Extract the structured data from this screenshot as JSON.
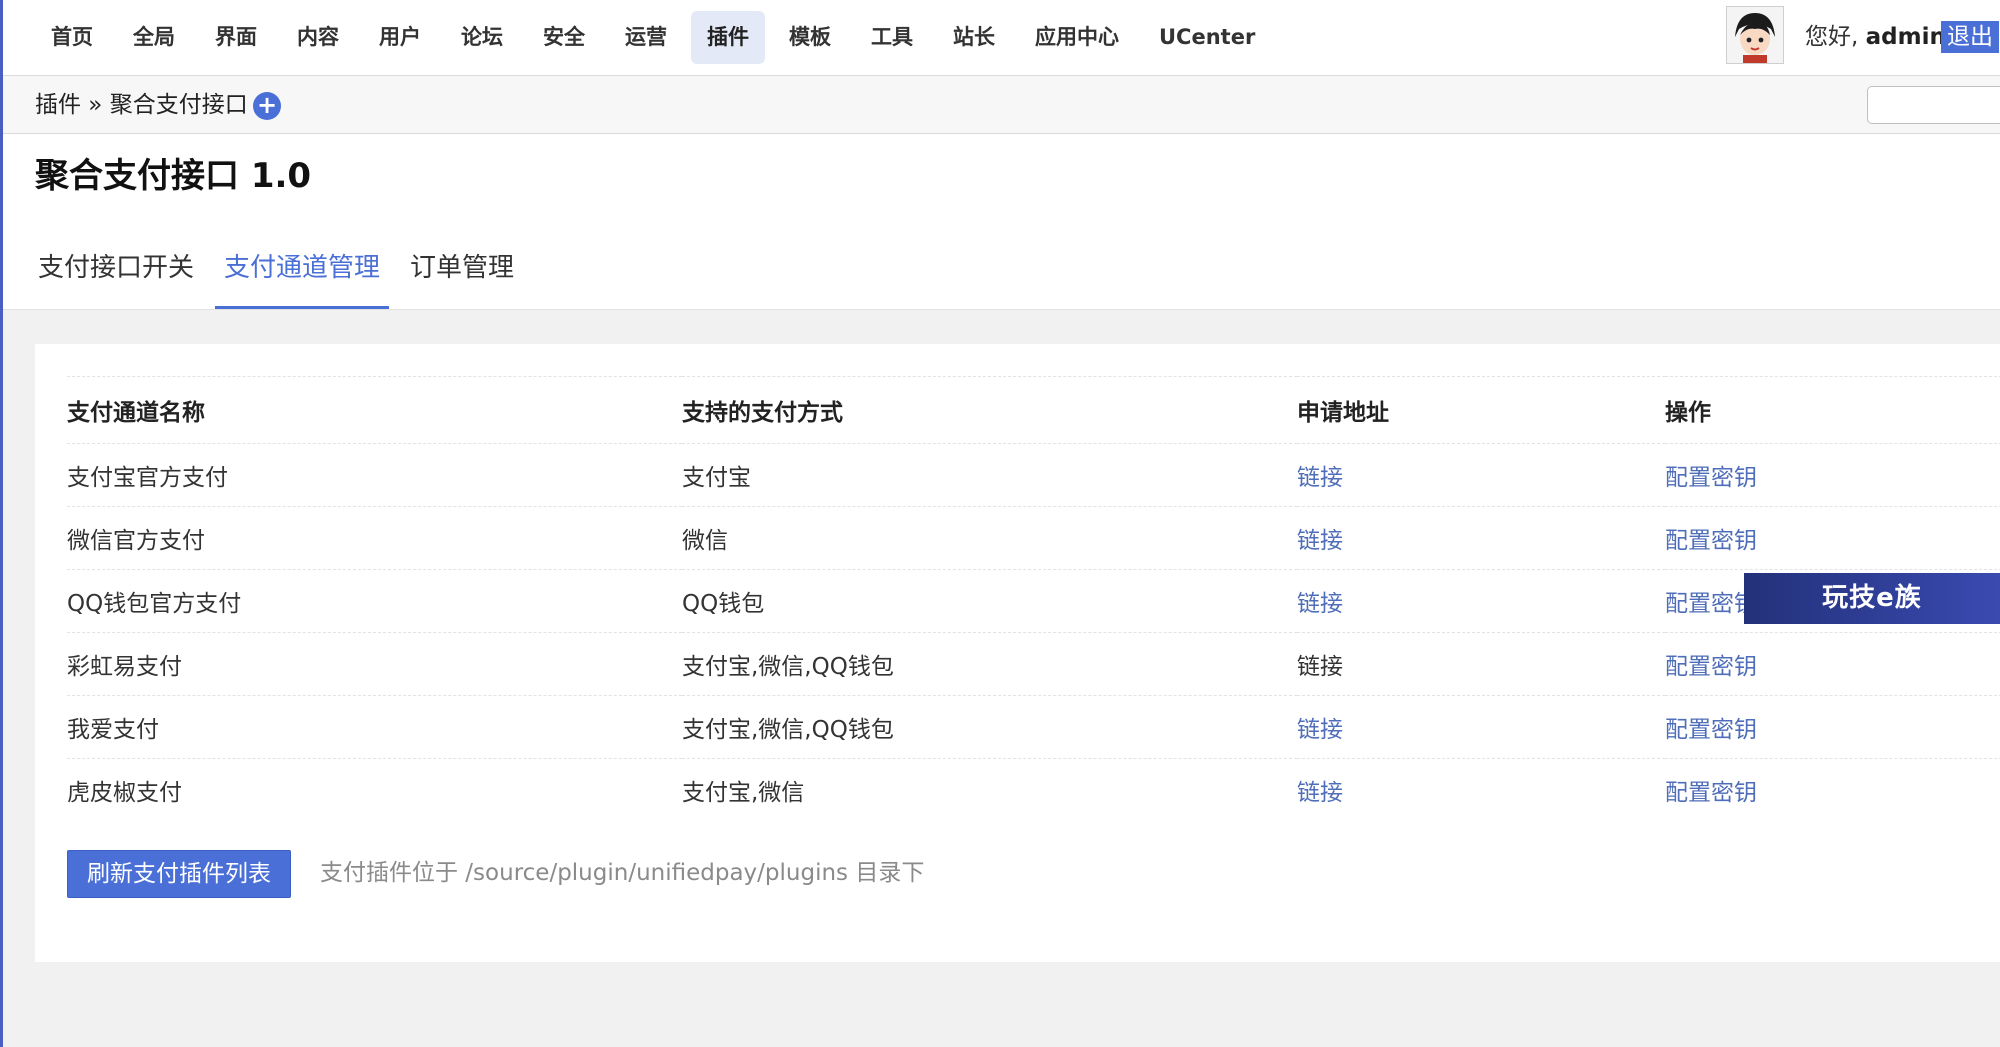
{
  "nav": {
    "items": [
      {
        "label": "首页"
      },
      {
        "label": "全局"
      },
      {
        "label": "界面"
      },
      {
        "label": "内容"
      },
      {
        "label": "用户"
      },
      {
        "label": "论坛"
      },
      {
        "label": "安全"
      },
      {
        "label": "运营"
      },
      {
        "label": "插件",
        "active": true
      },
      {
        "label": "模板"
      },
      {
        "label": "工具"
      },
      {
        "label": "站长"
      },
      {
        "label": "应用中心"
      },
      {
        "label": "UCenter"
      }
    ]
  },
  "user": {
    "greeting": "您好,",
    "name": "admin",
    "logout_label": "退出"
  },
  "breadcrumb": {
    "text": "插件 » 聚合支付接口",
    "add_icon": "plus-circle-icon"
  },
  "page": {
    "title": "聚合支付接口 1.0",
    "tabs": [
      {
        "label": "支付接口开关"
      },
      {
        "label": "支付通道管理",
        "active": true
      },
      {
        "label": "订单管理"
      }
    ]
  },
  "table": {
    "headers": [
      "支付通道名称",
      "支持的支付方式",
      "申请地址",
      "操作"
    ],
    "rows": [
      {
        "name": "支付宝官方支付",
        "methods": "支付宝",
        "link": "链接",
        "action": "配置密钥"
      },
      {
        "name": "微信官方支付",
        "methods": "微信",
        "link": "链接",
        "action": "配置密钥"
      },
      {
        "name": "QQ钱包官方支付",
        "methods": "QQ钱包",
        "link": "链接",
        "action": "配置密钥"
      },
      {
        "name": "彩虹易支付",
        "methods": "支付宝,微信,QQ钱包",
        "link": "链接",
        "action": "配置密钥"
      },
      {
        "name": "我爱支付",
        "methods": "支付宝,微信,QQ钱包",
        "link": "链接",
        "action": "配置密钥"
      },
      {
        "name": "虎皮椒支付",
        "methods": "支付宝,微信",
        "link": "链接",
        "action": "配置密钥"
      }
    ]
  },
  "footer": {
    "refresh_label": "刷新支付插件列表",
    "hint": "支付插件位于 /source/plugin/unifiedpay/plugins 目录下"
  },
  "watermark": {
    "text": "玩技e族"
  },
  "colors": {
    "accent": "#4a6fd6",
    "link": "#4f6db8",
    "active_nav_bg": "#e4e9f7"
  }
}
